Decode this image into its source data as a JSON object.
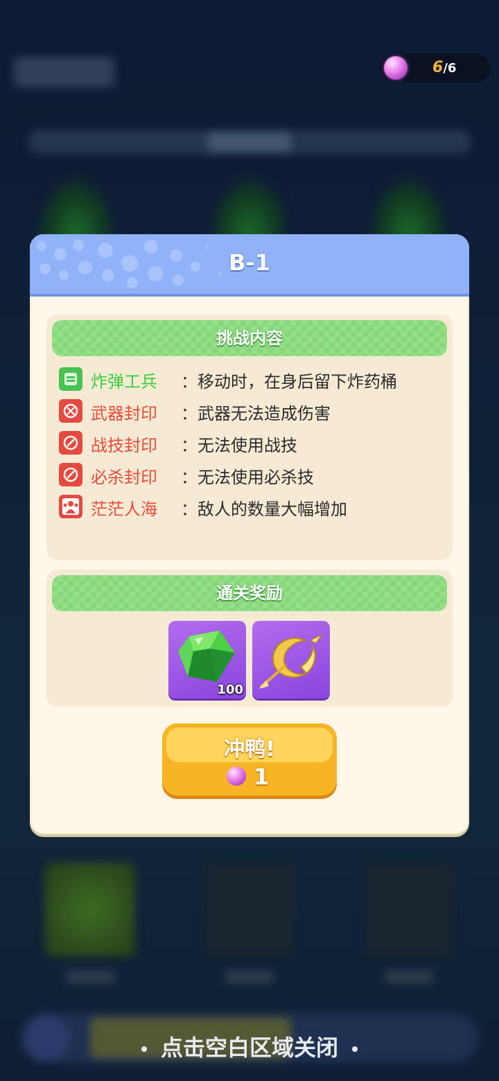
{
  "energy": {
    "current": "6",
    "max": "/6"
  },
  "dialog": {
    "title": "B-1",
    "challenge": {
      "header": "挑战内容",
      "rules": [
        {
          "name": "炸弹工兵",
          "colon": "：",
          "desc": "移动时，在身后留下炸药桶",
          "color": "#3ccd3c",
          "icon": "bomb-engineer-icon"
        },
        {
          "name": "武器封印",
          "colon": "：",
          "desc": "武器无法造成伤害",
          "color": "#ee4a38",
          "icon": "weapon-seal-icon"
        },
        {
          "name": "战技封印",
          "colon": "：",
          "desc": "无法使用战技",
          "color": "#ee4a38",
          "icon": "skill-seal-icon"
        },
        {
          "name": "必杀封印",
          "colon": "：",
          "desc": "无法使用必杀技",
          "color": "#ee4a38",
          "icon": "ultimate-seal-icon"
        },
        {
          "name": "茫茫人海",
          "colon": "：",
          "desc": "敌人的数量大幅增加",
          "color": "#ee4a38",
          "icon": "crowd-icon"
        }
      ]
    },
    "rewards": {
      "header": "通关奖励",
      "items": [
        {
          "icon": "green-gem-icon",
          "count": "100"
        },
        {
          "icon": "golden-crescent-icon",
          "count": ""
        }
      ]
    },
    "go_button": {
      "label": "冲鸭!",
      "cost": "1",
      "cost_icon": "energy-orb-icon"
    }
  },
  "close_hint": "点击空白区域关闭"
}
